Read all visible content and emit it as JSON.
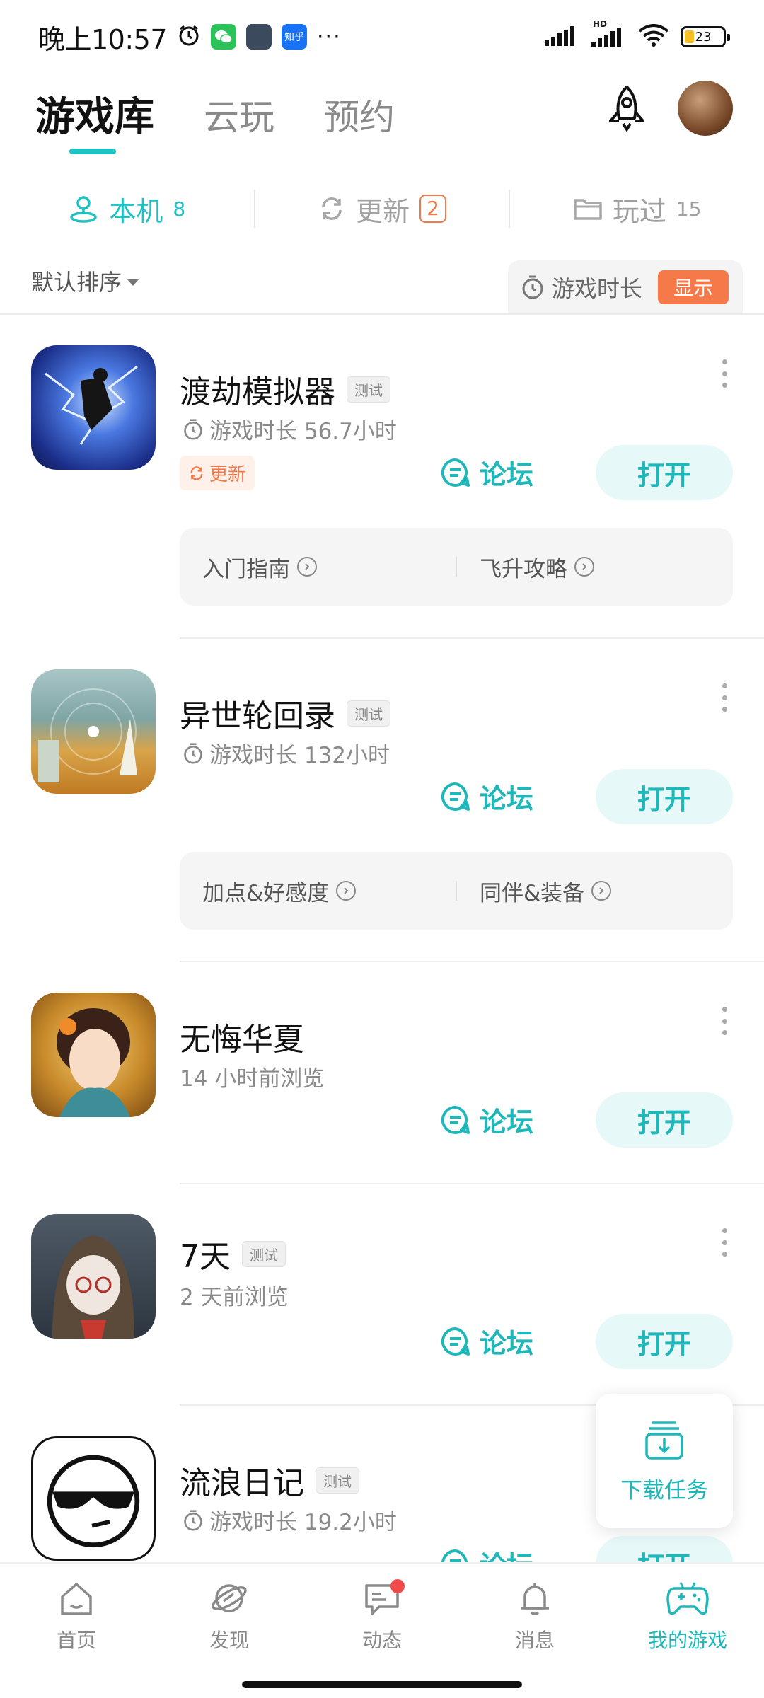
{
  "status_bar": {
    "time": "晚上10:57",
    "app_icons": [
      "alarm-icon",
      "wechat-icon",
      "game-notification-icon",
      "zhihu-icon"
    ],
    "zhihu_label": "知乎",
    "more": "···",
    "hd_label": "HD",
    "battery_level": "23"
  },
  "header": {
    "tabs": [
      {
        "label": "游戏库",
        "active": true
      },
      {
        "label": "云玩",
        "active": false
      },
      {
        "label": "预约",
        "active": false
      }
    ],
    "accent_color": "#1fc1c3"
  },
  "subtabs": [
    {
      "label": "本机",
      "count": "8",
      "icon": "user-location-icon"
    },
    {
      "label": "更新",
      "count": "2",
      "icon": "refresh-icon"
    },
    {
      "label": "玩过",
      "count": "15",
      "icon": "folder-icon"
    }
  ],
  "sort": {
    "label": "默认排序",
    "playtime_label": "游戏时长",
    "show_label": "显示"
  },
  "games": [
    {
      "title": "渡劫模拟器",
      "tag": "测试",
      "sub": "游戏时长 56.7小时",
      "update": "更新",
      "forum": "论坛",
      "open": "打开",
      "guides": [
        "入门指南",
        "飞升攻略"
      ]
    },
    {
      "title": "异世轮回录",
      "tag": "测试",
      "sub": "游戏时长 132小时",
      "forum": "论坛",
      "open": "打开",
      "guides": [
        "加点&好感度",
        "同伴&装备"
      ]
    },
    {
      "title": "无悔华夏",
      "sub": "14 小时前浏览",
      "forum": "论坛",
      "open": "打开"
    },
    {
      "title": "7天",
      "tag": "测试",
      "sub": "2 天前浏览",
      "forum": "论坛",
      "open": "打开"
    },
    {
      "title": "流浪日记",
      "tag": "测试",
      "sub": "游戏时长 19.2小时",
      "forum": "论坛",
      "open": "打开"
    }
  ],
  "download_fab": {
    "label": "下载任务"
  },
  "bottom_nav": [
    {
      "label": "首页",
      "icon": "home-icon"
    },
    {
      "label": "发现",
      "icon": "discover-planet-icon"
    },
    {
      "label": "动态",
      "icon": "chat-bubble-icon"
    },
    {
      "label": "消息",
      "icon": "bell-icon"
    },
    {
      "label": "我的游戏",
      "icon": "gamepad-icon",
      "active": true
    }
  ]
}
